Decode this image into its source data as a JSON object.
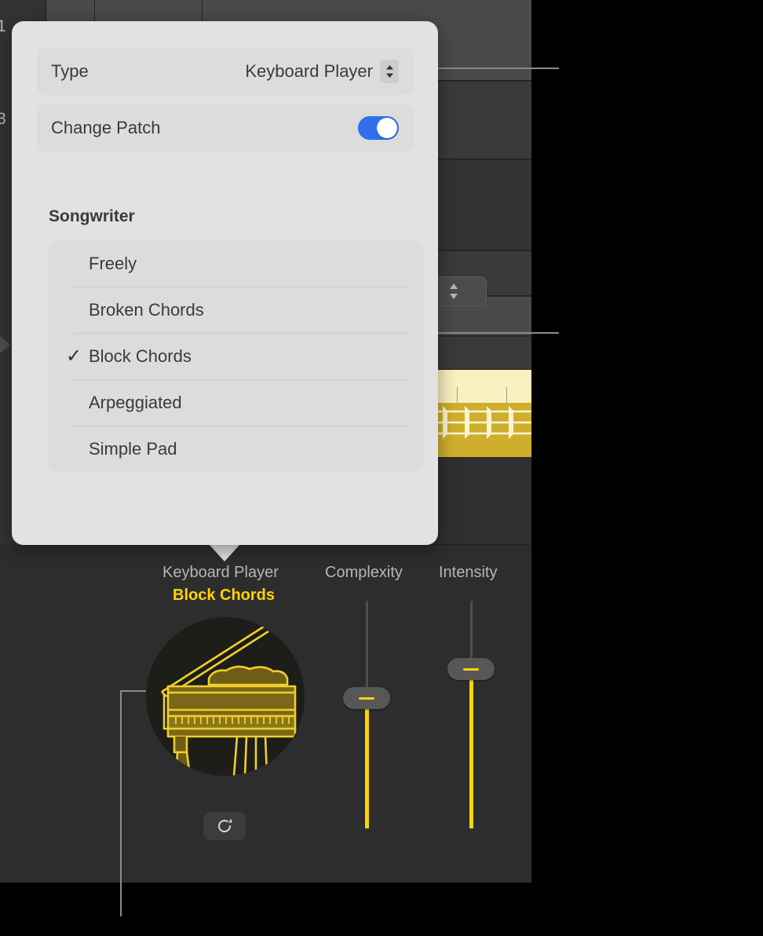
{
  "window": {
    "ruler_numbers": [
      "1",
      "3"
    ],
    "background_name": "logic-pro-tracks-area"
  },
  "popover": {
    "type_row": {
      "label": "Type",
      "value": "Keyboard Player",
      "stepper_icon": "chevron-up-down-icon"
    },
    "change_patch_row": {
      "label": "Change Patch",
      "toggle_state": "on",
      "toggle_color": "#2f6feb"
    },
    "section_title": "Songwriter",
    "style_options": [
      {
        "label": "Freely",
        "selected": false
      },
      {
        "label": "Broken Chords",
        "selected": false
      },
      {
        "label": "Block Chords",
        "selected": true
      },
      {
        "label": "Arpeggiated",
        "selected": false
      },
      {
        "label": "Simple Pad",
        "selected": false
      }
    ],
    "checkmark_glyph": "✓"
  },
  "player": {
    "instrument_label": "Keyboard Player",
    "style_label": "Block Chords",
    "style_color": "#ffd400",
    "instrument_icon": "grand-piano-icon",
    "regenerate_icon": "refresh-clockwise-icon",
    "sliders": [
      {
        "name": "Complexity",
        "label": "Complexity",
        "value_percent": 57
      },
      {
        "name": "Intensity",
        "label": "Intensity",
        "value_percent": 70
      }
    ]
  }
}
